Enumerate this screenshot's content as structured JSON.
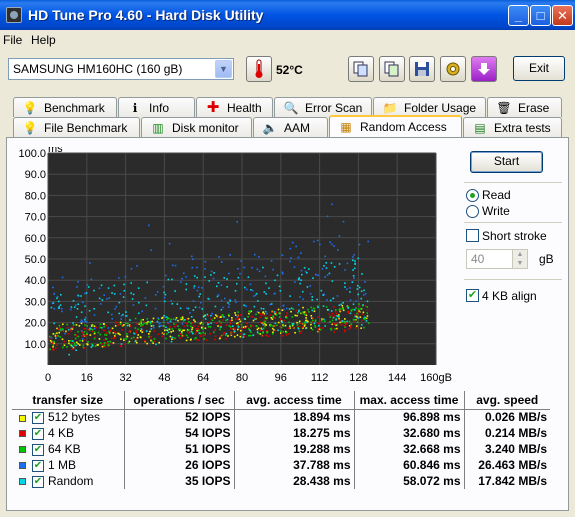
{
  "window": {
    "title": "HD Tune Pro 4.60 - Hard Disk Utility",
    "min": "_",
    "max": "□",
    "close": "✕"
  },
  "menu": {
    "file": "File",
    "help": "Help"
  },
  "toolbar": {
    "drive": "SAMSUNG HM160HC (160 gB)",
    "temperature": "52°C",
    "exit": "Exit"
  },
  "tabs_top": [
    {
      "label": "Benchmark",
      "icon": "bulb-icon"
    },
    {
      "label": "Info",
      "icon": "info-icon"
    },
    {
      "label": "Health",
      "icon": "health-cross-icon"
    },
    {
      "label": "Error Scan",
      "icon": "magnifier-icon"
    },
    {
      "label": "Folder Usage",
      "icon": "folder-icon"
    },
    {
      "label": "Erase",
      "icon": "trash-icon"
    }
  ],
  "tabs_bottom": [
    {
      "label": "File Benchmark",
      "icon": "file-bulb-icon"
    },
    {
      "label": "Disk monitor",
      "icon": "bar-chart-icon"
    },
    {
      "label": "AAM",
      "icon": "speaker-icon"
    },
    {
      "label": "Random Access",
      "icon": "random-access-icon",
      "active": true
    },
    {
      "label": "Extra tests",
      "icon": "extra-tests-icon"
    }
  ],
  "options": {
    "start": "Start",
    "read": "Read",
    "write": "Write",
    "mode": "read",
    "short_stroke": "Short stroke",
    "short_stroke_checked": false,
    "stroke_value": "40",
    "stroke_unit": "gB",
    "kb_align": "4 KB align",
    "kb_align_checked": true
  },
  "chart_data": {
    "type": "scatter",
    "ylabel": "ms",
    "ylim": [
      0,
      100
    ],
    "y_ticks": [
      "100.0",
      "90.0",
      "80.0",
      "70.0",
      "60.0",
      "50.0",
      "40.0",
      "30.0",
      "20.0",
      "10.0"
    ],
    "xlim": [
      0,
      160
    ],
    "x_ticks": [
      "0",
      "16",
      "32",
      "48",
      "64",
      "80",
      "96",
      "112",
      "128",
      "144",
      "160gB"
    ],
    "background": "#2B2B2B",
    "grid": true,
    "series": [
      {
        "name": "512 bytes",
        "color": "#F7F700",
        "mean_ms": 18.894
      },
      {
        "name": "4 KB",
        "color": "#E00000",
        "mean_ms": 18.275
      },
      {
        "name": "64 KB",
        "color": "#00C800",
        "mean_ms": 19.288
      },
      {
        "name": "1 MB",
        "color": "#1E6EF0",
        "mean_ms": 37.788
      },
      {
        "name": "Random",
        "color": "#00D8E8",
        "mean_ms": 28.438
      }
    ]
  },
  "table": {
    "headers": [
      "transfer size",
      "operations / sec",
      "avg. access time",
      "max. access time",
      "avg. speed"
    ],
    "rows": [
      {
        "name": "512 bytes",
        "color": "#F7F700",
        "ops": "52 IOPS",
        "avg": "18.894 ms",
        "max": "96.898 ms",
        "speed": "0.026 MB/s"
      },
      {
        "name": "4 KB",
        "color": "#E00000",
        "ops": "54 IOPS",
        "avg": "18.275 ms",
        "max": "32.680 ms",
        "speed": "0.214 MB/s"
      },
      {
        "name": "64 KB",
        "color": "#00C800",
        "ops": "51 IOPS",
        "avg": "19.288 ms",
        "max": "32.668 ms",
        "speed": "3.240 MB/s"
      },
      {
        "name": "1 MB",
        "color": "#1E6EF0",
        "ops": "26 IOPS",
        "avg": "37.788 ms",
        "max": "60.846 ms",
        "speed": "26.463 MB/s"
      },
      {
        "name": "Random",
        "color": "#00D8E8",
        "ops": "35 IOPS",
        "avg": "28.438 ms",
        "max": "58.072 ms",
        "speed": "17.842 MB/s"
      }
    ]
  }
}
